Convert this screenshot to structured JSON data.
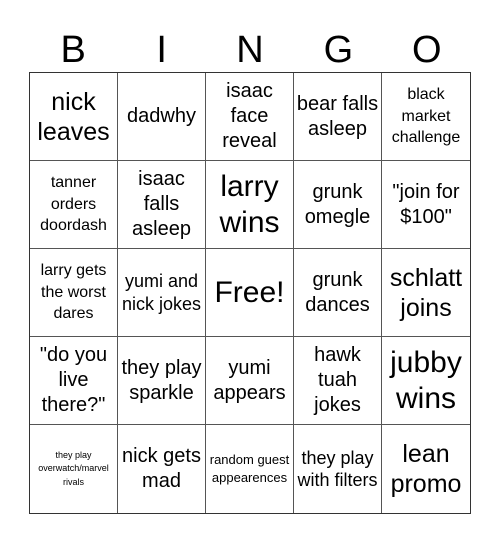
{
  "header": [
    "B",
    "I",
    "N",
    "G",
    "O"
  ],
  "cells": [
    {
      "text": "nick leaves",
      "size": "l"
    },
    {
      "text": "dadwhy",
      "size": "m"
    },
    {
      "text": "isaac face reveal",
      "size": "m"
    },
    {
      "text": "bear falls asleep",
      "size": "m"
    },
    {
      "text": "black market challenge",
      "size": "s"
    },
    {
      "text": "tanner orders doordash",
      "size": "s"
    },
    {
      "text": "isaac falls asleep",
      "size": "m"
    },
    {
      "text": "larry wins",
      "size": "xl"
    },
    {
      "text": "grunk omegle",
      "size": "m"
    },
    {
      "text": "\"join for $100\"",
      "size": "m"
    },
    {
      "text": "larry gets the worst dares",
      "size": "s"
    },
    {
      "text": "yumi and nick jokes",
      "size": "ms"
    },
    {
      "text": "Free!",
      "size": "xl"
    },
    {
      "text": "grunk dances",
      "size": "m"
    },
    {
      "text": "schlatt joins",
      "size": "l"
    },
    {
      "text": "\"do you live there?\"",
      "size": "m"
    },
    {
      "text": "they play sparkle",
      "size": "m"
    },
    {
      "text": "yumi appears",
      "size": "m"
    },
    {
      "text": "hawk tuah jokes",
      "size": "m"
    },
    {
      "text": "jubby wins",
      "size": "xl"
    },
    {
      "text": "they play overwatch/marvel rivals",
      "size": "xxs"
    },
    {
      "text": "nick gets mad",
      "size": "m"
    },
    {
      "text": "random guest appearences",
      "size": "xs"
    },
    {
      "text": "they play with filters",
      "size": "ms"
    },
    {
      "text": "lean promo",
      "size": "l"
    }
  ]
}
